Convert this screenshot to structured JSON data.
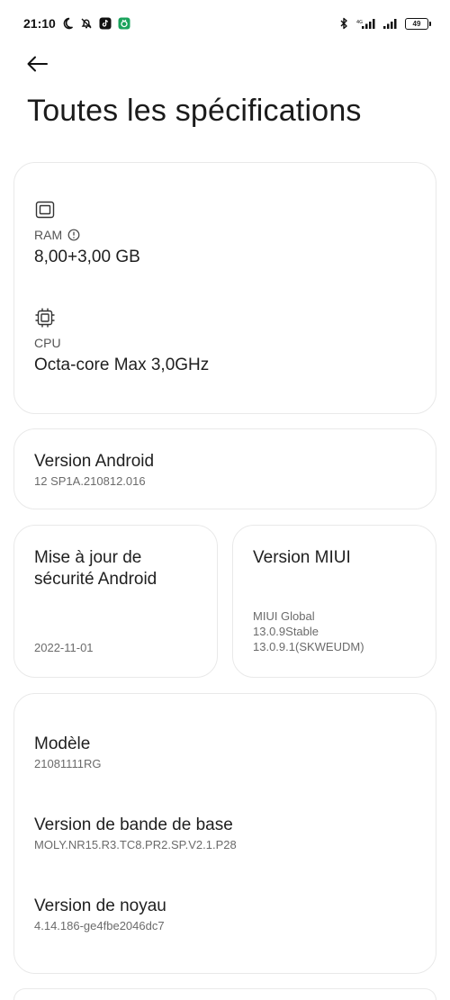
{
  "status_bar": {
    "time": "21:10",
    "battery_level": "49",
    "icons": [
      "moon-icon",
      "bell-off-icon",
      "tiktok-icon",
      "app-icon",
      "bluetooth-icon",
      "signal-icon",
      "battery-icon"
    ]
  },
  "header": {
    "title": "Toutes les spécifications"
  },
  "hardware": {
    "ram_label": "RAM",
    "ram_value": "8,00+3,00 GB",
    "cpu_label": "CPU",
    "cpu_value": "Octa-core Max 3,0GHz"
  },
  "android": {
    "title": "Version Android",
    "value": "12 SP1A.210812.016"
  },
  "security": {
    "title_line1": "Mise à jour de",
    "title_line2": "sécurité Android",
    "value": "2022-11-01"
  },
  "miui": {
    "title": "Version MIUI",
    "line1": "MIUI Global",
    "line2": "13.0.9Stable",
    "line3": "13.0.9.1(SKWEUDM)"
  },
  "details": {
    "model_title": "Modèle",
    "model_value": "21081111RG",
    "baseband_title": "Version de bande de base",
    "baseband_value": "MOLY.NR15.R3.TC8.PR2.SP.V2.1.P28",
    "kernel_title": "Version de noyau",
    "kernel_value": "4.14.186-ge4fbe2046dc7"
  }
}
